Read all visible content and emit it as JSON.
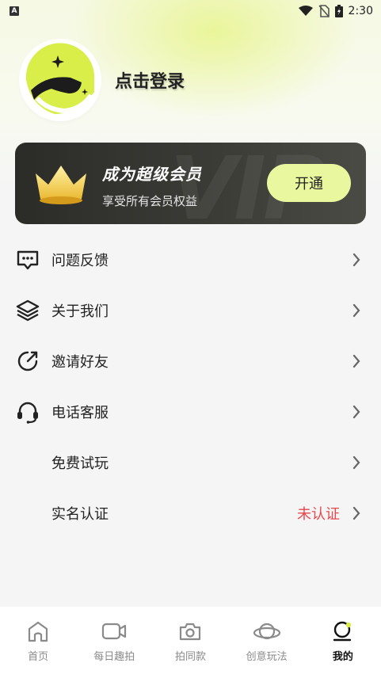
{
  "status_bar": {
    "app_badge": "A",
    "time": "2:30"
  },
  "profile": {
    "login_text": "点击登录"
  },
  "vip": {
    "watermark": "VIP",
    "title": "成为超级会员",
    "subtitle": "享受所有会员权益",
    "button_label": "开通"
  },
  "menu": {
    "items": [
      {
        "label": "问题反馈",
        "icon": "feedback-icon"
      },
      {
        "label": "关于我们",
        "icon": "layers-icon"
      },
      {
        "label": "邀请好友",
        "icon": "share-icon"
      },
      {
        "label": "电话客服",
        "icon": "headset-icon"
      },
      {
        "label": "免费试玩",
        "icon": ""
      },
      {
        "label": "实名认证",
        "icon": "",
        "status": "未认证"
      }
    ]
  },
  "tabs": [
    {
      "label": "首页",
      "icon": "home-icon"
    },
    {
      "label": "每日趣拍",
      "icon": "video-camera-icon"
    },
    {
      "label": "拍同款",
      "icon": "camera-icon"
    },
    {
      "label": "创意玩法",
      "icon": "planet-icon"
    },
    {
      "label": "我的",
      "icon": "profile-icon",
      "active": true
    }
  ],
  "colors": {
    "accent": "#e9f79e",
    "vip_card": "#3a3a35",
    "warning_text": "#e5484d"
  }
}
